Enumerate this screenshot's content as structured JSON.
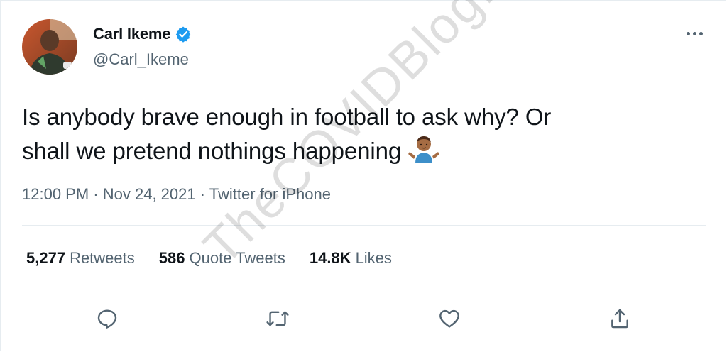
{
  "tweet": {
    "author": {
      "name": "Carl Ikeme",
      "handle": "@Carl_Ikeme",
      "verified": true,
      "avatar_icon": "profile-photo"
    },
    "text_line1": "Is anybody brave enough in football to ask why? Or",
    "text_line2": "shall we pretend nothings happening",
    "emoji": "person-shrugging-emoji",
    "time": "12:00 PM",
    "separator": "·",
    "date": "Nov 24, 2021",
    "source": "Twitter for iPhone",
    "stats": {
      "retweets_count": "5,277",
      "retweets_label": "Retweets",
      "quotes_count": "586",
      "quotes_label": "Quote Tweets",
      "likes_count": "14.8K",
      "likes_label": "Likes"
    },
    "actions": [
      "reply-icon",
      "retweet-icon",
      "like-icon",
      "share-icon"
    ]
  },
  "watermark": "TheCOVIDBlog.com",
  "colors": {
    "primary_text": "#0f1419",
    "secondary_text": "#536471",
    "verified_blue": "#1d9bf0",
    "border": "#e6ecf0"
  }
}
